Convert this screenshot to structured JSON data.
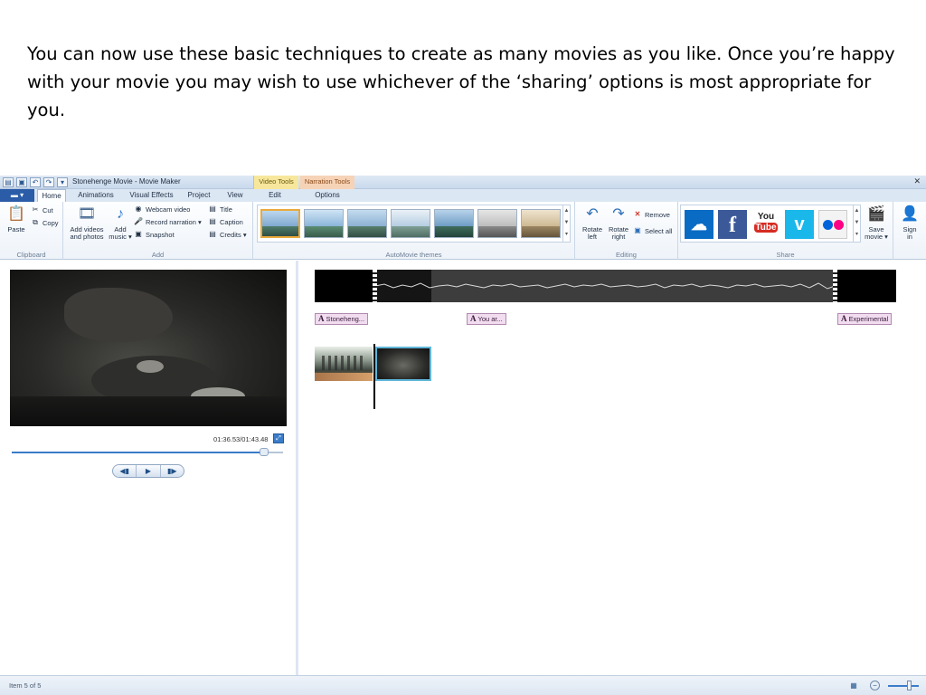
{
  "caption": "You can now use these basic techniques to create as many movies as you like. Once you’re happy with your movie you may wish to use whichever of the ‘sharing’ options is most appropriate for you.",
  "window": {
    "title": "Stonehenge Movie - Movie Maker",
    "context_tabs": [
      "Video Tools",
      "Narration Tools"
    ]
  },
  "tabs": [
    "Home",
    "Animations",
    "Visual Effects",
    "Project",
    "View",
    "Edit",
    "Options"
  ],
  "ribbon": {
    "clipboard": {
      "label": "Clipboard",
      "paste": "Paste",
      "cut": "Cut",
      "copy": "Copy"
    },
    "add": {
      "label": "Add",
      "add_videos": [
        "Add videos",
        "and photos"
      ],
      "add_music": [
        "Add",
        "music ▾"
      ],
      "webcam": "Webcam video",
      "record_narration": "Record narration ▾",
      "snapshot": "Snapshot",
      "title": "Title",
      "caption": "Caption",
      "credits": "Credits ▾"
    },
    "themes": {
      "label": "AutoMovie themes"
    },
    "editing": {
      "label": "Editing",
      "rotate_left": [
        "Rotate",
        "left"
      ],
      "rotate_right": [
        "Rotate",
        "right"
      ],
      "remove": "Remove",
      "select_all": "Select all"
    },
    "share": {
      "label": "Share",
      "services": [
        "skydrive-icon",
        "facebook-icon",
        "youtube-icon",
        "vimeo-icon",
        "flickr-icon"
      ],
      "youtube_text": [
        "You",
        "Tube"
      ],
      "save_movie": [
        "Save",
        "movie ▾"
      ],
      "sign_in": [
        "Sign",
        "in"
      ]
    }
  },
  "preview": {
    "timecode": "01:36.53/01:43.48",
    "progress": 0.93
  },
  "storyboard": {
    "captions": [
      "Stoneheng...",
      "You ar...",
      "Experimental"
    ]
  },
  "status": {
    "item_text": "Item 5 of 5"
  },
  "colors": {
    "accent": "#3a7cc9",
    "facebook": "#3b5998",
    "youtube": "#d62b23",
    "vimeo": "#1ab7ea",
    "skydrive": "#0a6bc4"
  }
}
